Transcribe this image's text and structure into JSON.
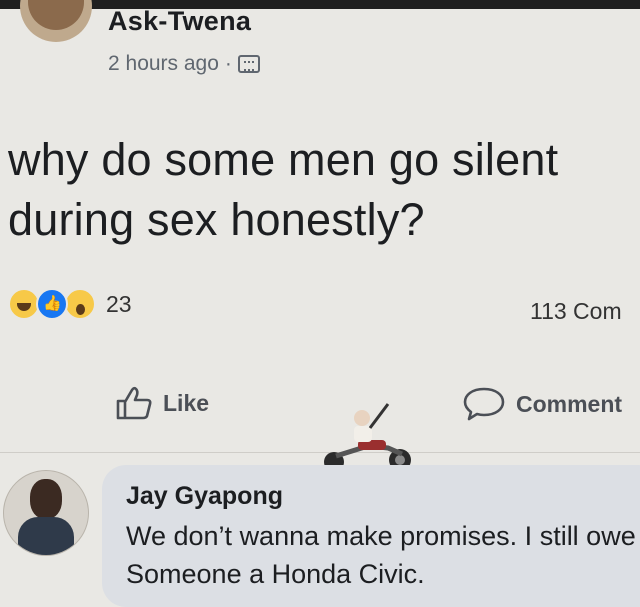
{
  "post": {
    "author": "Ask-Twena",
    "time": "2 hours ago",
    "separator": "·",
    "privacy_icon": "globe-icon",
    "text": "why do some men go silent during sex honestly?"
  },
  "reactions": {
    "icons": [
      "haha-icon",
      "like-icon",
      "wow-icon"
    ],
    "count": "23",
    "comments_count_text": "113 Com"
  },
  "actions": {
    "like_label": "Like",
    "comment_label": "Comment"
  },
  "comment": {
    "author": "Jay Gyapong",
    "text": "We don’t wanna make promises. I still owe Someone a Honda Civic."
  },
  "colors": {
    "background": "#e9e8e4",
    "comment_bubble": "#dcdfe4",
    "like_blue": "#1877f2",
    "reaction_yellow": "#f7c948",
    "muted_text": "#606770"
  }
}
